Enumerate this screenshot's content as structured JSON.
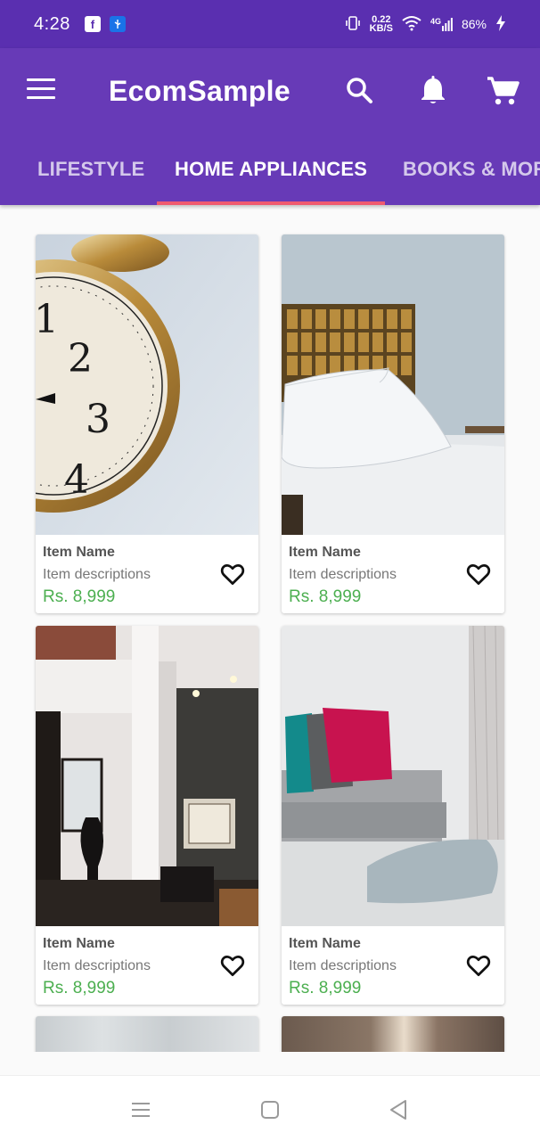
{
  "status": {
    "time": "4:28",
    "net_speed_value": "0.22",
    "net_speed_unit": "KB/S",
    "network": "4G",
    "battery": "86%"
  },
  "toolbar": {
    "title": "EcomSample",
    "icons": [
      "menu-icon",
      "search-icon",
      "bell-icon",
      "cart-icon"
    ]
  },
  "tabs": [
    {
      "label": "LIFESTYLE",
      "active": false
    },
    {
      "label": "HOME APPLIANCES",
      "active": true
    },
    {
      "label": "BOOKS & MORE",
      "active": false
    }
  ],
  "colors": {
    "primary": "#673ab7",
    "status_bar": "#5a2fb0",
    "tab_indicator": "#ef5a6f",
    "price": "#4caf50"
  },
  "products": [
    {
      "name": "Item Name",
      "description": "Item descriptions",
      "price": "Rs. 8,999",
      "image": "alarm-clock"
    },
    {
      "name": "Item Name",
      "description": "Item descriptions",
      "price": "Rs. 8,999",
      "image": "bed-with-pillows"
    },
    {
      "name": "Item Name",
      "description": "Item descriptions",
      "price": "Rs. 8,999",
      "image": "living-room-interior"
    },
    {
      "name": "Item Name",
      "description": "Item descriptions",
      "price": "Rs. 8,999",
      "image": "grey-sofa-cushions"
    }
  ],
  "nav": {
    "icons": [
      "recent-apps-icon",
      "home-icon",
      "back-icon"
    ]
  }
}
